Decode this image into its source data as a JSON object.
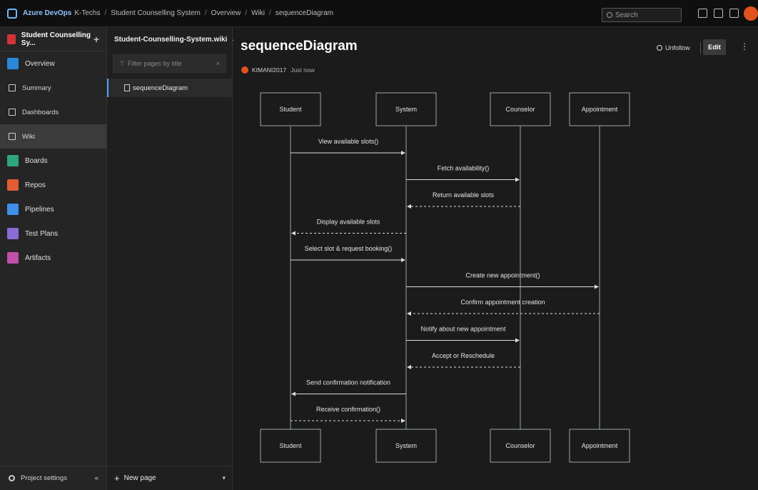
{
  "topbar": {
    "brand": "Azure DevOps",
    "org": "K-Techs",
    "crumbs": [
      "Student Counselling System",
      "Overview",
      "Wiki",
      "sequenceDiagram"
    ],
    "search_placeholder": "Search"
  },
  "leftnav": {
    "project_name": "Student Counselling Sy...",
    "items": [
      {
        "label": "Overview",
        "icon": "overview-icon",
        "color": "#2b88d8"
      },
      {
        "label": "Summary",
        "icon": "summary-icon",
        "color": ""
      },
      {
        "label": "Dashboards",
        "icon": "dashboards-icon",
        "color": ""
      },
      {
        "label": "Wiki",
        "icon": "wiki-icon",
        "color": ""
      },
      {
        "label": "Boards",
        "icon": "boards-icon",
        "color": "#2ea67b"
      },
      {
        "label": "Repos",
        "icon": "repos-icon",
        "color": "#e05d33"
      },
      {
        "label": "Pipelines",
        "icon": "pipelines-icon",
        "color": "#3f8ee8"
      },
      {
        "label": "Test Plans",
        "icon": "test-plans-icon",
        "color": "#8b6bd6"
      },
      {
        "label": "Artifacts",
        "icon": "artifacts-icon",
        "color": "#c04fa8"
      }
    ],
    "footer": "Project settings"
  },
  "wikipane": {
    "wiki_name": "Student-Counselling-System.wiki",
    "filter_placeholder": "Filter pages by title",
    "page": "sequenceDiagram",
    "new_page": "New page"
  },
  "content": {
    "title": "sequenceDiagram",
    "author": "KIMANI2017",
    "when": "Just now",
    "unfollow": "Unfollow",
    "edit": "Edit"
  },
  "diagram": {
    "participants": [
      "Student",
      "System",
      "Counselor",
      "Appointment"
    ],
    "messages": [
      {
        "from": 0,
        "to": 1,
        "label": "View available slots()",
        "kind": "solid"
      },
      {
        "from": 1,
        "to": 2,
        "label": "Fetch availability()",
        "kind": "solid"
      },
      {
        "from": 2,
        "to": 1,
        "label": "Return available slots",
        "kind": "dashed"
      },
      {
        "from": 1,
        "to": 0,
        "label": "Display available slots",
        "kind": "dashed"
      },
      {
        "from": 0,
        "to": 1,
        "label": "Select slot & request booking()",
        "kind": "solid"
      },
      {
        "from": 1,
        "to": 3,
        "label": "Create new appointment()",
        "kind": "solid"
      },
      {
        "from": 3,
        "to": 1,
        "label": "Confirm appointment creation",
        "kind": "dashed"
      },
      {
        "from": 1,
        "to": 2,
        "label": "Notify about new appointment",
        "kind": "solid"
      },
      {
        "from": 2,
        "to": 1,
        "label": "Accept or Reschedule",
        "kind": "dashed"
      },
      {
        "from": 1,
        "to": 0,
        "label": "Send confirmation notification",
        "kind": "solid"
      },
      {
        "from": 0,
        "to": 1,
        "label": "Receive confirmation()",
        "kind": "dashed"
      }
    ]
  }
}
